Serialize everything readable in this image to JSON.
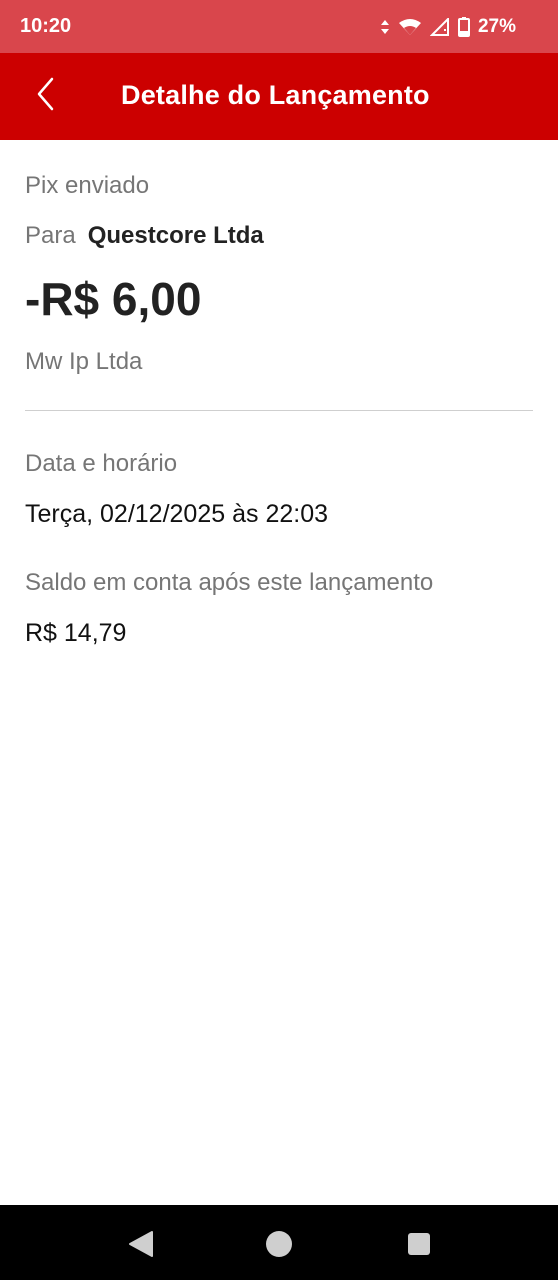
{
  "status_bar": {
    "time": "10:20",
    "battery": "27%",
    "icons": [
      "data-transfer-icon",
      "wifi-icon",
      "cell-signal-icon",
      "battery-icon"
    ]
  },
  "header": {
    "title": "Detalhe do Lançamento",
    "back_icon": "chevron-left-icon",
    "color": "#cc0000"
  },
  "transaction": {
    "type": "Pix enviado",
    "to_label": "Para",
    "recipient": "Questcore Ltda",
    "amount": "-R$ 6,00",
    "institution": "Mw Ip Ltda"
  },
  "details": {
    "date_label": "Data e horário",
    "date_value": "Terça, 02/12/2025 às 22:03",
    "balance_label": "Saldo em conta após este lançamento",
    "balance_value": "R$ 14,79"
  },
  "nav": {
    "icons": [
      "nav-back-icon",
      "nav-home-icon",
      "nav-recent-icon"
    ]
  }
}
